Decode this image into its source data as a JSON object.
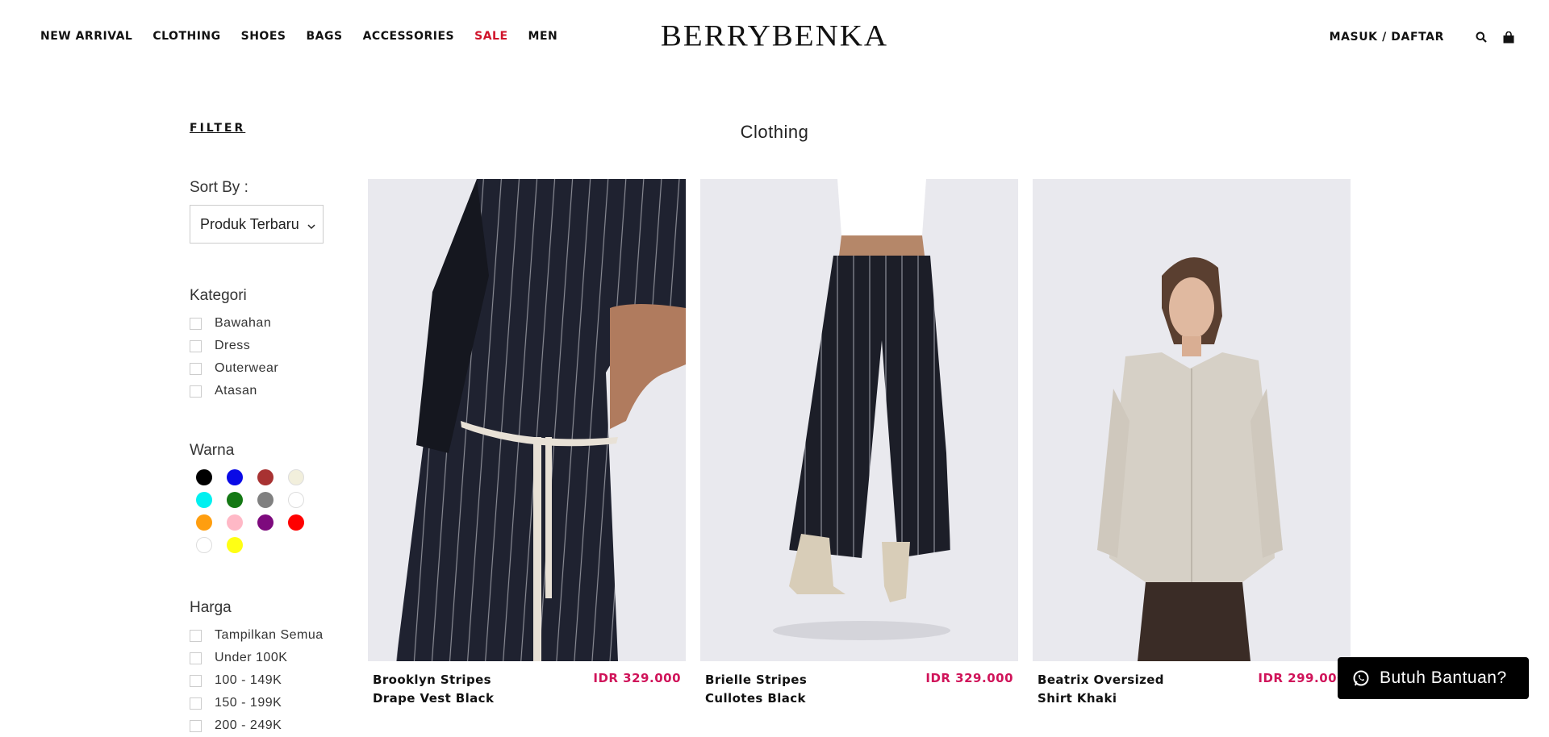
{
  "header": {
    "nav": [
      "NEW ARRIVAL",
      "CLOTHING",
      "SHOES",
      "BAGS",
      "ACCESSORIES",
      "SALE",
      "MEN"
    ],
    "logo": "BERRYBENKA",
    "login": "MASUK / DAFTAR",
    "icons": [
      "search-icon",
      "cart-icon"
    ]
  },
  "sidebar": {
    "filter_title": "FILTER",
    "sort_label": "Sort By :",
    "sort_value": "Produk Terbaru",
    "kategori_title": "Kategori",
    "kategori": [
      "Bawahan",
      "Dress",
      "Outerwear",
      "Atasan"
    ],
    "warna_title": "Warna",
    "warna": [
      "#000000",
      "#0a0ae6",
      "#a83232",
      "#f2efdc",
      "#00f0f0",
      "#147814",
      "#808080",
      "#ffffff",
      "#ff9e0f",
      "#ffb8c6",
      "#7d0a7d",
      "#ff0000",
      "#ffffff",
      "#ffff14"
    ],
    "harga_title": "Harga",
    "harga": [
      "Tampilkan Semua",
      "Under 100K",
      "100 - 149K",
      "150 - 199K",
      "200 - 249K"
    ]
  },
  "main": {
    "title": "Clothing",
    "products": [
      {
        "name": "Brooklyn Stripes Drape Vest Black",
        "price": "IDR 329.000"
      },
      {
        "name": "Brielle Stripes Cullotes Black",
        "price": "IDR 329.000"
      },
      {
        "name": "Beatrix Oversized Shirt Khaki",
        "price": "IDR 299.000"
      }
    ]
  },
  "help": {
    "label": "Butuh Bantuan?"
  },
  "colors": {
    "sale": "#d0142b",
    "price": "#d0145a",
    "photo_bg": "#e7e7ec"
  }
}
